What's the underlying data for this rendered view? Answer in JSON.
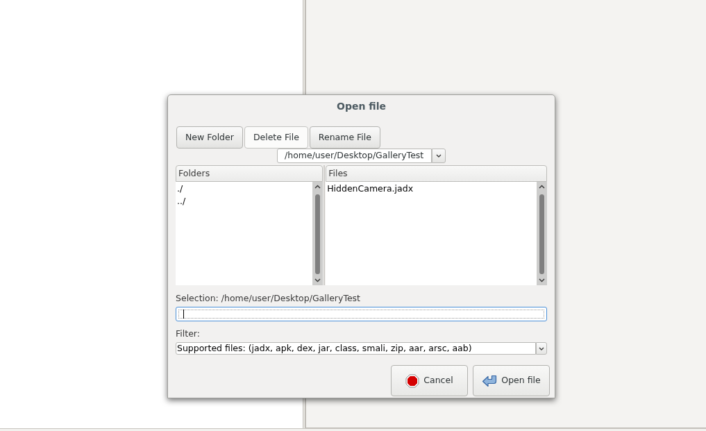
{
  "window": {
    "title": "Open file"
  },
  "toolbar_buttons": [
    {
      "label": "New Folder",
      "hovered": false
    },
    {
      "label": "Delete File",
      "hovered": true
    },
    {
      "label": "Rename File",
      "hovered": false
    }
  ],
  "path": {
    "value": "/home/user/Desktop/GalleryTest"
  },
  "folders": {
    "header": "Folders",
    "items": [
      {
        "label": "./",
        "selected": false
      },
      {
        "label": "../",
        "selected": false
      }
    ]
  },
  "files": {
    "header": "Files",
    "items": [
      {
        "label": "HiddenCamera.jadx",
        "selected": false
      }
    ]
  },
  "selection": {
    "label": "Selection: /home/user/Desktop/GalleryTest",
    "focused": true
  },
  "filter": {
    "label": "Filter:",
    "value": "Supported files: (jadx, apk, dex, jar, class, smali, zip, aar, arsc, aab)"
  },
  "buttons": [
    {
      "label": "Cancel",
      "kind": "cancel"
    },
    {
      "label": "Open file",
      "kind": "open"
    }
  ]
}
